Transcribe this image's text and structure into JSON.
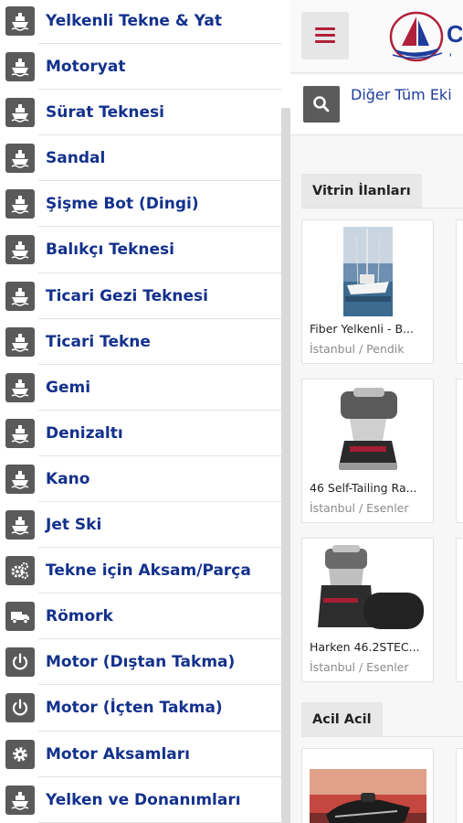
{
  "drawer": {
    "items": [
      {
        "label": "Yelkenli Tekne & Yat",
        "icon": "ship-icon"
      },
      {
        "label": "Motoryat",
        "icon": "ship-icon"
      },
      {
        "label": "Sürat Teknesi",
        "icon": "ship-icon"
      },
      {
        "label": "Sandal",
        "icon": "ship-icon"
      },
      {
        "label": "Şişme Bot (Dingi)",
        "icon": "ship-icon"
      },
      {
        "label": "Balıkçı Teknesi",
        "icon": "ship-icon"
      },
      {
        "label": "Ticari Gezi Teknesi",
        "icon": "ship-icon"
      },
      {
        "label": "Ticari Tekne",
        "icon": "ship-icon"
      },
      {
        "label": "Gemi",
        "icon": "ship-icon"
      },
      {
        "label": "Denizaltı",
        "icon": "ship-icon"
      },
      {
        "label": "Kano",
        "icon": "ship-icon"
      },
      {
        "label": "Jet Ski",
        "icon": "ship-icon"
      },
      {
        "label": "Tekne için Aksam/Parça",
        "icon": "gears-icon"
      },
      {
        "label": "Römork",
        "icon": "truck-icon"
      },
      {
        "label": "Motor (Dıştan Takma)",
        "icon": "power-icon"
      },
      {
        "label": "Motor (İçten Takma)",
        "icon": "power-icon"
      },
      {
        "label": "Motor Aksamları",
        "icon": "gear-icon"
      },
      {
        "label": "Yelken ve Donanımları",
        "icon": "ship-icon"
      }
    ]
  },
  "header": {
    "menu_icon": "hamburger-icon",
    "logo_icon": "sailboat-logo-icon",
    "logo_fragment": "C",
    "accent_color": "#b0213a",
    "link_color": "#13318c"
  },
  "search": {
    "icon": "search-icon",
    "text": "Diğer Tüm Eki"
  },
  "sections": {
    "showcase": {
      "title": "Vitrin İlanları",
      "cards": [
        {
          "title": "Fiber Yelkenli - B...",
          "location": "İstanbul / Pendik",
          "thumb": "sailboat-photo"
        },
        {
          "title": "46 Self-Tailing Ra...",
          "location": "İstanbul / Esenler",
          "thumb": "winch-photo"
        },
        {
          "title": "Harken 46.2STEC...",
          "location": "İstanbul / Esenler",
          "thumb": "electric-winch-photo"
        }
      ]
    },
    "urgent": {
      "title": "Acil Acil",
      "cards": [
        {
          "thumb": "jetski-photo"
        }
      ]
    }
  }
}
